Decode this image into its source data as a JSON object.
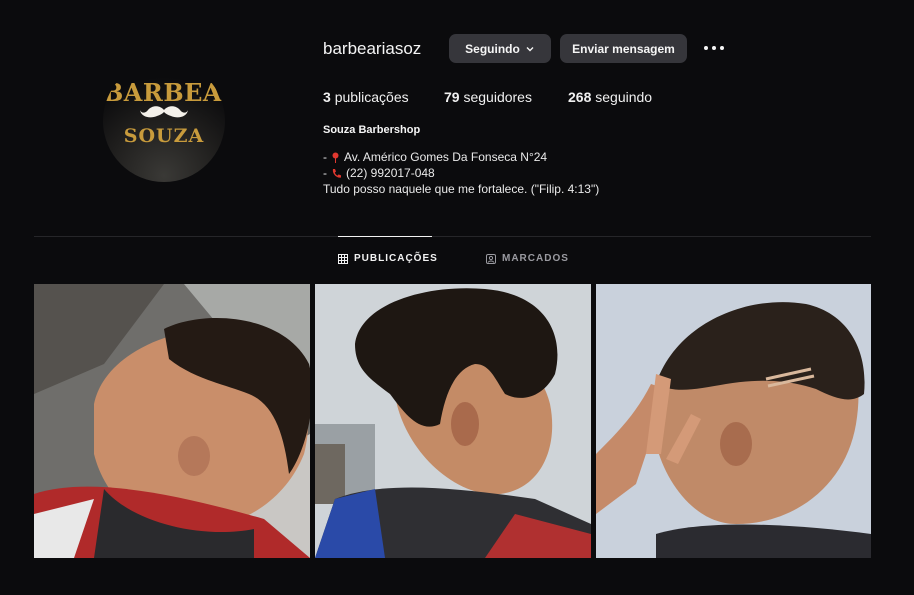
{
  "profile": {
    "username": "barbeariasoz",
    "avatar": {
      "logo_top": "BARBEARIA",
      "logo_bottom": "SOUZA",
      "icon": "mustache-icon"
    },
    "follow_button": "Seguindo",
    "message_button": "Enviar mensagem",
    "stats": {
      "posts_count": "3",
      "posts_label": "publicações",
      "followers_count": "79",
      "followers_label": "seguidores",
      "following_count": "268",
      "following_label": "seguindo"
    },
    "display_name": "Souza Barbershop",
    "bio": {
      "line1_prefix": "-",
      "line1_text": "Av. Américo Gomes Da Fonseca N°24",
      "line2_prefix": "-",
      "line2_text": "(22) 992017-048",
      "line3_text": "Tudo posso naquele que me fortalece. (\"Filip. 4:13\")"
    }
  },
  "tabs": [
    {
      "label": "PUBLICAÇÕES",
      "icon": "grid-icon",
      "active": true
    },
    {
      "label": "MARCADOS",
      "icon": "tagged-icon",
      "active": false
    }
  ],
  "posts": [
    {
      "description_icon": "haircut-photo-side-fade"
    },
    {
      "description_icon": "haircut-photo-curly-fade"
    },
    {
      "description_icon": "haircut-photo-fade-design"
    }
  ],
  "colors": {
    "background": "#0b0b0d",
    "button": "#36363b",
    "logo_gold": "#c89b3c",
    "pin_red": "#e0382f"
  }
}
